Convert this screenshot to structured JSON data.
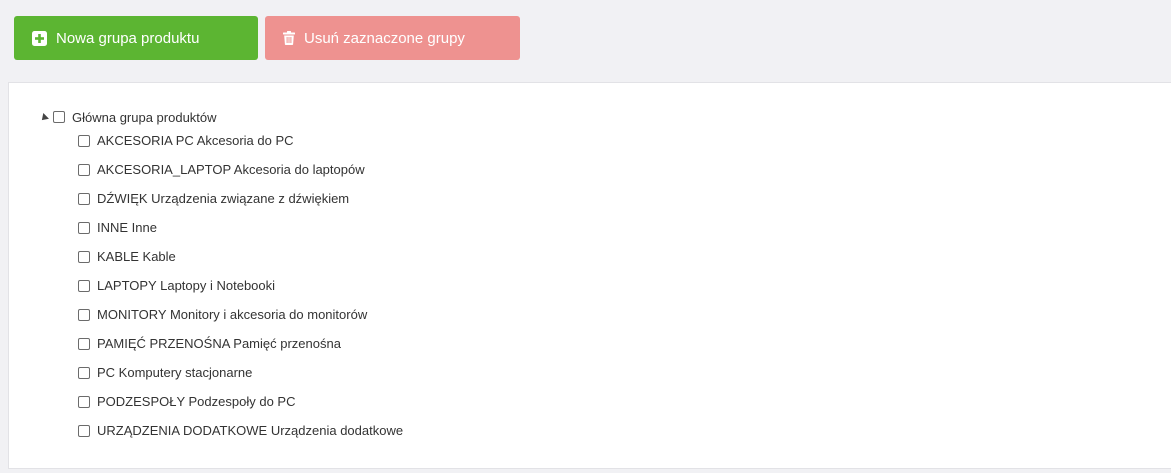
{
  "toolbar": {
    "new_group_label": "Nowa grupa produktu",
    "delete_selected_label": "Usuń zaznaczone grupy"
  },
  "tree": {
    "root_label": "Główna grupa produktów",
    "children": [
      "AKCESORIA PC Akcesoria do PC",
      "AKCESORIA_LAPTOP Akcesoria do laptopów",
      "DŹWIĘK Urządzenia związane z dźwiękiem",
      "INNE Inne",
      "KABLE Kable",
      "LAPTOPY Laptopy i Notebooki",
      "MONITORY Monitory i akcesoria do monitorów",
      "PAMIĘĆ PRZENOŚNA Pamięć przenośna",
      "PC Komputery stacjonarne",
      "PODZESPOŁY Podzespoły do PC",
      "URZĄDZENIA DODATKOWE Urządzenia dodatkowe"
    ]
  },
  "colors": {
    "new_button": "#5cb532",
    "delete_button": "#ee9290",
    "page_background": "#f1f1f4"
  }
}
